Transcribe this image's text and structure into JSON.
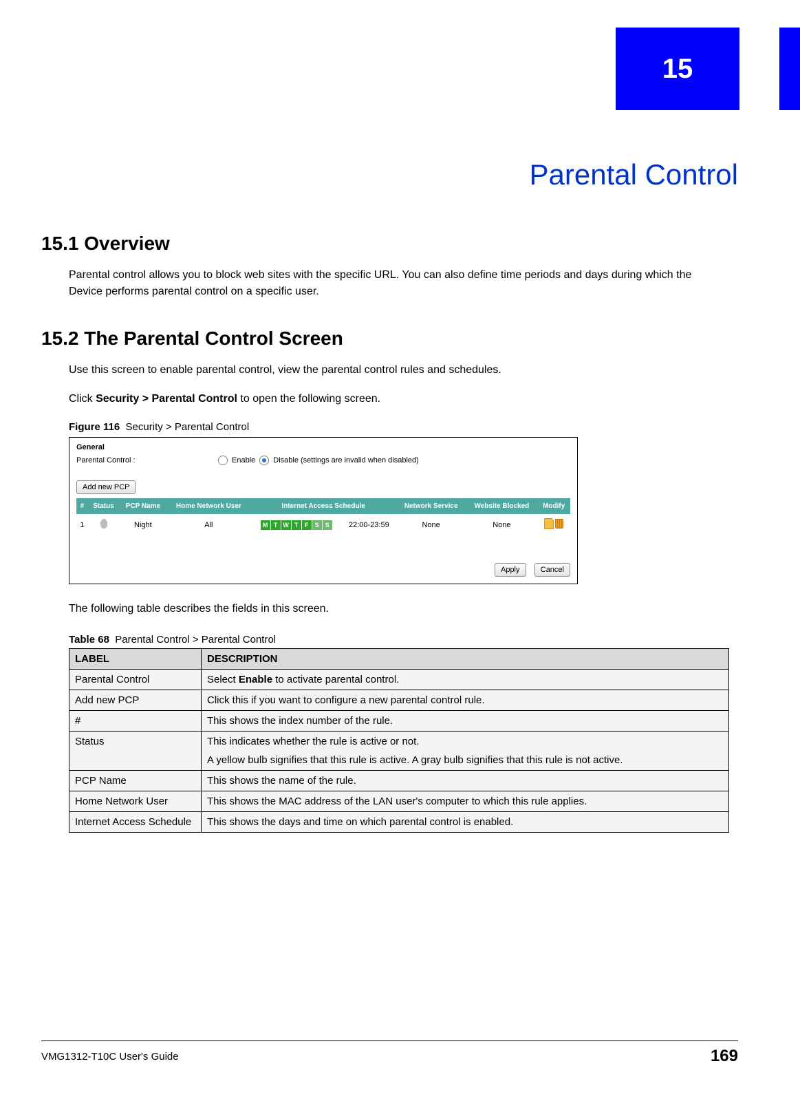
{
  "chapter": {
    "number": "15",
    "title": "Parental Control"
  },
  "sections": {
    "s1": {
      "heading": "15.1  Overview",
      "body": "Parental control allows you to block web sites with the specific URL. You can also define time periods and days during which the Device performs parental control on a specific user."
    },
    "s2": {
      "heading": "15.2  The Parental Control Screen",
      "body1": "Use this screen to enable parental control, view the parental control rules and schedules.",
      "body2_pre": "Click ",
      "body2_bold": "Security > Parental Control",
      "body2_post": " to open the following screen."
    }
  },
  "figure": {
    "label": "Figure 116",
    "caption": "Security > Parental Control"
  },
  "screenshot": {
    "section_title": "General",
    "label": "Parental Control :",
    "enable": "Enable",
    "disable": "Disable (settings are invalid when disabled)",
    "selected": "disable",
    "add_button": "Add new PCP",
    "headers": {
      "num": "#",
      "status": "Status",
      "pcp": "PCP Name",
      "user": "Home Network User",
      "schedule": "Internet Access Schedule",
      "service": "Network Service",
      "blocked": "Website Blocked",
      "modify": "Modify"
    },
    "row": {
      "num": "1",
      "pcp": "Night",
      "user": "All",
      "days": [
        "M",
        "T",
        "W",
        "T",
        "F",
        "S",
        "S"
      ],
      "time": "22:00-23:59",
      "service": "None",
      "blocked": "None"
    },
    "apply": "Apply",
    "cancel": "Cancel"
  },
  "after_figure": "The following table describes the fields in this screen.",
  "table": {
    "label": "Table 68",
    "caption": "Parental Control > Parental Control",
    "h1": "LABEL",
    "h2": "DESCRIPTION",
    "rows": [
      {
        "label": "Parental Control",
        "desc_pre": "Select ",
        "desc_bold": "Enable",
        "desc_post": " to activate parental control."
      },
      {
        "label": "Add new PCP",
        "desc": "Click this if you want to configure a new parental control rule."
      },
      {
        "label": "#",
        "desc": "This shows the index number of the rule."
      },
      {
        "label": "Status",
        "desc_p1": "This indicates whether the rule is active or not.",
        "desc_p2": "A yellow bulb signifies that this rule is active. A gray bulb signifies that this rule is not active."
      },
      {
        "label": "PCP Name",
        "desc": "This shows the name of the rule."
      },
      {
        "label": "Home Network User",
        "desc": "This shows the MAC address of the LAN user's computer to which this rule applies."
      },
      {
        "label": "Internet Access Schedule",
        "desc": "This shows the days and time on which parental control is enabled."
      }
    ]
  },
  "footer": {
    "guide": "VMG1312-T10C User's Guide",
    "page": "169"
  }
}
